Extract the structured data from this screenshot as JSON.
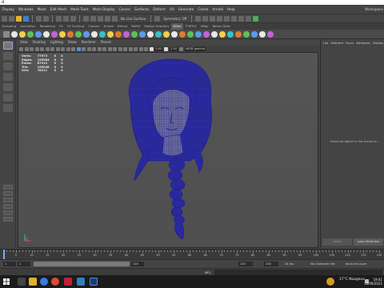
{
  "os_title": "d",
  "menu": {
    "items": [
      "Display",
      "Windows",
      "Mesh",
      "Edit Mesh",
      "Mesh Tools",
      "Mesh Display",
      "Curves",
      "Surfaces",
      "Deform",
      "UV",
      "Generate",
      "Cache",
      "Arnold",
      "Help"
    ],
    "workspace": "Workspace"
  },
  "status": {
    "no_live_surface": "No Live Surface",
    "symmetry": "Symmetry: Off"
  },
  "shelf_tabs": [
    "Sculpting",
    "Animation",
    "Rendering",
    "FX",
    "FX Caching",
    "Custom",
    "Arnold",
    "Bifrost",
    "MASH",
    "Motion Graphics",
    "XGen",
    "TURTLE",
    "VRay",
    "Bonus Tools"
  ],
  "shelf_active_tab": 10,
  "panel_menu": [
    "View",
    "Shading",
    "Lighting",
    "Show",
    "Renderer",
    "Panels"
  ],
  "panel_toolbar": {
    "field1": "0.00",
    "field2": "1.00",
    "colorspace": "sRGB gamma"
  },
  "hud": {
    "rows": [
      [
        "Verts:",
        "77973",
        "0",
        "0"
      ],
      [
        "Edges:",
        "155984",
        "0",
        "0"
      ],
      [
        "Faces:",
        "87912",
        "0",
        "0"
      ],
      [
        "Tris:",
        "155948",
        "0",
        "0"
      ],
      [
        "UVs:",
        "78211",
        "0",
        "0"
      ]
    ]
  },
  "right_panel": {
    "tabs": [
      "List",
      "Selected",
      "Focus",
      "Attributes",
      "Display"
    ],
    "message": "Select an object in the scene for ...",
    "select_btn": "Select",
    "load_btn": "Load Attributes"
  },
  "timeline": {
    "ticks": [
      "5",
      "10",
      "15",
      "20",
      "25",
      "30",
      "35",
      "40",
      "45",
      "50",
      "55",
      "60",
      "65",
      "70",
      "75",
      "80",
      "85",
      "90",
      "95",
      "100",
      "105",
      "110",
      "115",
      "120"
    ],
    "current_frame": 1
  },
  "range": {
    "start": "1",
    "start_inner": "1",
    "end_inner": "120",
    "end": "120",
    "end2": "200",
    "fps": "24 fps",
    "no_character_set": "No Character Set",
    "no_anim_layer": "No Anim Layer"
  },
  "cmdline": {
    "label": "MEL"
  },
  "taskbar": {
    "weather": "17°C  Nuageux",
    "time": "19:41",
    "date": "18/09/2021"
  },
  "colors": {
    "wireframe": "#1a1a99",
    "accent": "#5b8fd0"
  }
}
